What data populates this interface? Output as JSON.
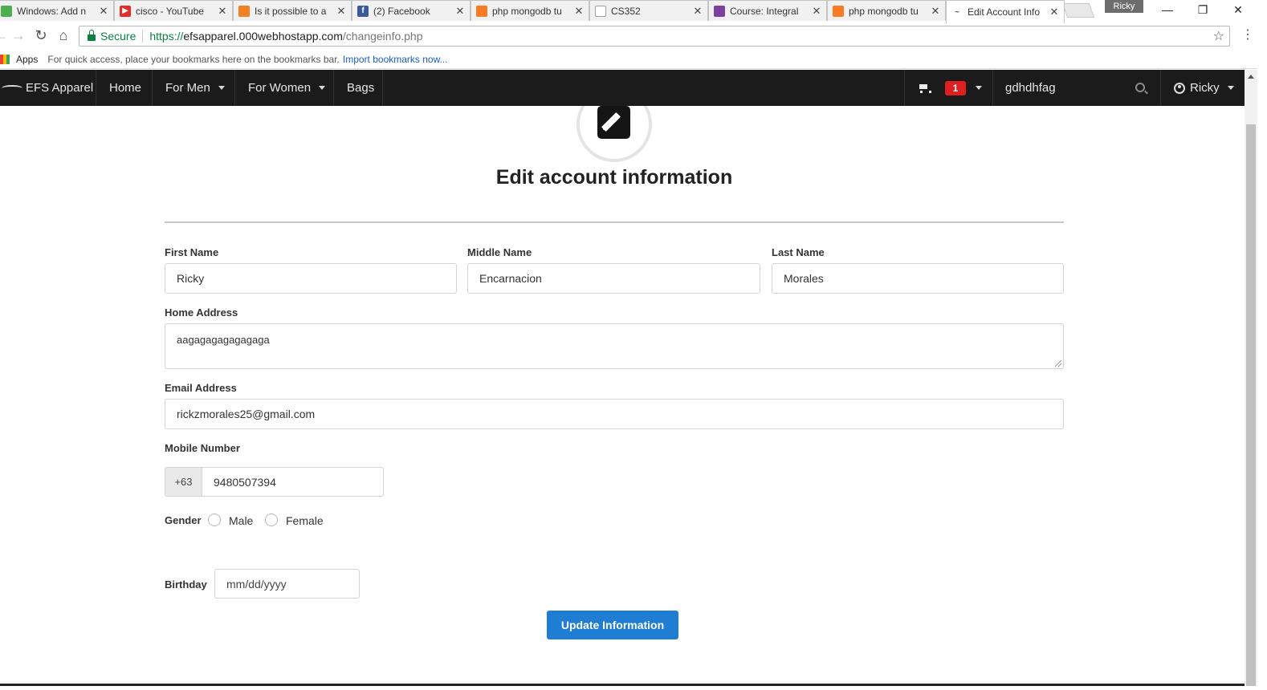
{
  "browser": {
    "tabs": [
      {
        "title": "Windows: Add n",
        "icon": "green-shield-icon",
        "color": "#4caf50"
      },
      {
        "title": "cisco - YouTube",
        "icon": "youtube-icon",
        "color": "#e52d27"
      },
      {
        "title": "Is it possible to a",
        "icon": "stackoverflow-icon",
        "color": "#f48024"
      },
      {
        "title": "(2) Facebook",
        "icon": "facebook-icon",
        "color": "#3b5998"
      },
      {
        "title": "php mongodb tu",
        "icon": "xampp-icon",
        "color": "#fb7a24"
      },
      {
        "title": "CS352",
        "icon": "document-icon",
        "color": "#9e9e9e"
      },
      {
        "title": "Course: Integral",
        "icon": "school-shield-icon",
        "color": "#7b3fa0"
      },
      {
        "title": "php mongodb tu",
        "icon": "xampp-icon",
        "color": "#fb7a24"
      },
      {
        "title": "Edit Account Info",
        "icon": "efs-logo-icon",
        "color": "#555555",
        "active": true
      }
    ],
    "close_glyph": "✕",
    "profile_name": "Ricky",
    "window_controls": {
      "minimize": "—",
      "restore": "❐",
      "close": "✕"
    },
    "nav": {
      "back": "←",
      "forward": "→",
      "reload": "↻",
      "home": "⌂"
    },
    "omnibox": {
      "secure_label": "Secure",
      "url_scheme": "https://",
      "url_host": "efsapparel.000webhostapp.com",
      "url_path": "/changeinfo.php"
    },
    "bookmarks_bar": {
      "apps_label": "Apps",
      "message": "For quick access, place your bookmarks here on the bookmarks bar.",
      "import_link": "Import bookmarks now..."
    }
  },
  "site_nav": {
    "brand": "EFS Apparel",
    "items": [
      {
        "label": "Home",
        "has_caret": false
      },
      {
        "label": "For Men",
        "has_caret": true
      },
      {
        "label": "For Women",
        "has_caret": true
      },
      {
        "label": "Bags",
        "has_caret": false
      }
    ],
    "cart_count": "1",
    "search_value": "gdhdhfag",
    "user_name": "Ricky",
    "background": "#1b1b1b"
  },
  "form": {
    "title": "Edit account information",
    "first_name_label": "First Name",
    "first_name_value": "Ricky",
    "middle_name_label": "Middle Name",
    "middle_name_value": "Encarnacion",
    "last_name_label": "Last Name",
    "last_name_value": "Morales",
    "address_label": "Home Address",
    "address_value": "aagagagagagagaga",
    "email_label": "Email Address",
    "email_value": "rickzmorales25@gmail.com",
    "mobile_label": "Mobile Number",
    "mobile_prefix": "+63",
    "mobile_value": "9480507394",
    "gender_label": "Gender",
    "gender_options": [
      "Male",
      "Female"
    ],
    "birthday_label": "Birthday",
    "birthday_placeholder": "mm/dd/yyyy",
    "submit_label": "Update Information",
    "accent_color": "#1f7ed3"
  }
}
